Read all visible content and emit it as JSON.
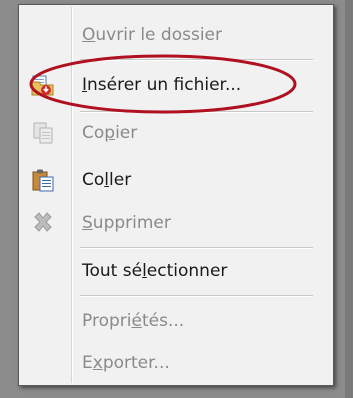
{
  "menu": {
    "items": [
      {
        "id": "open-folder",
        "pre": "",
        "u": "O",
        "post": "uvrir le dossier",
        "disabled": true,
        "icon": "none"
      },
      {
        "id": "insert-file",
        "pre": "",
        "u": "I",
        "post": "nsérer un fichier...",
        "disabled": false,
        "icon": "insert-file-icon"
      },
      {
        "id": "copy",
        "pre": "Co",
        "u": "p",
        "post": "ier",
        "disabled": true,
        "icon": "copy-icon"
      },
      {
        "id": "paste",
        "pre": "Co",
        "u": "l",
        "post": "ler",
        "disabled": false,
        "icon": "paste-icon"
      },
      {
        "id": "delete",
        "pre": "",
        "u": "S",
        "post": "upprimer",
        "disabled": true,
        "icon": "delete-icon"
      },
      {
        "id": "select-all",
        "pre": "Tout sé",
        "u": "l",
        "post": "ectionner",
        "disabled": false,
        "icon": "none"
      },
      {
        "id": "properties",
        "pre": "Propri",
        "u": "é",
        "post": "tés...",
        "disabled": true,
        "icon": "none"
      },
      {
        "id": "export",
        "pre": "E",
        "u": "x",
        "post": "porter...",
        "disabled": true,
        "icon": "none"
      }
    ]
  },
  "colors": {
    "highlight_ellipse": "#b01020",
    "menu_background": "#f1f1f1",
    "disabled_text": "#8a8a8a"
  }
}
